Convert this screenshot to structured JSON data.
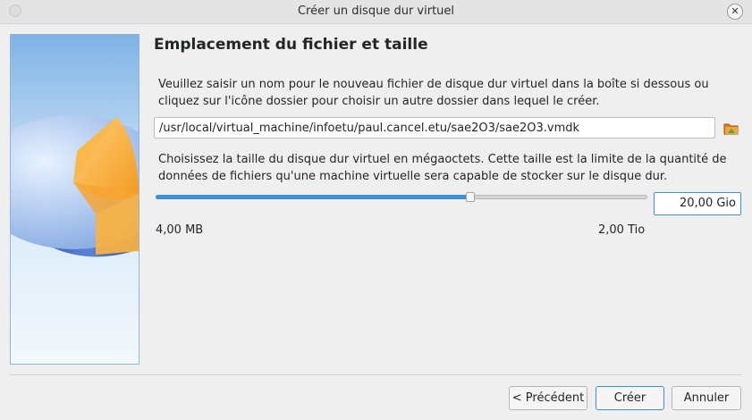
{
  "window": {
    "title": "Créer un disque dur virtuel",
    "close_glyph": "✕"
  },
  "page": {
    "heading": "Emplacement du fichier et taille",
    "intro_line1": "Veuillez saisir un nom pour le nouveau fichier de disque dur virtuel dans la boîte si dessous ou",
    "intro_line2": "cliquez sur l'icône dossier pour choisir un autre dossier dans lequel le créer.",
    "file_path": "/usr/local/virtual_machine/infoetu/paul.cancel.etu/sae2O3/sae2O3.vmdk",
    "folder_icon": "folder-icon",
    "size_line1": "Choisissez la taille du disque dur virtuel en mégaoctets. Cette taille est la limite de la quantité de",
    "size_line2": "données de fichiers qu'une machine virtuelle sera capable de stocker sur le disque dur.",
    "slider_fraction": 0.642,
    "size_value": "20,00 Gio",
    "range_min": "4,00 MB",
    "range_max": "2,00 Tio"
  },
  "buttons": {
    "back": "< Précédent",
    "create": "Créer",
    "cancel": "Annuler"
  },
  "colors": {
    "accent": "#3d8fd6",
    "pie_blue": "#3a63c4",
    "pie_orange": "#f7a531"
  }
}
